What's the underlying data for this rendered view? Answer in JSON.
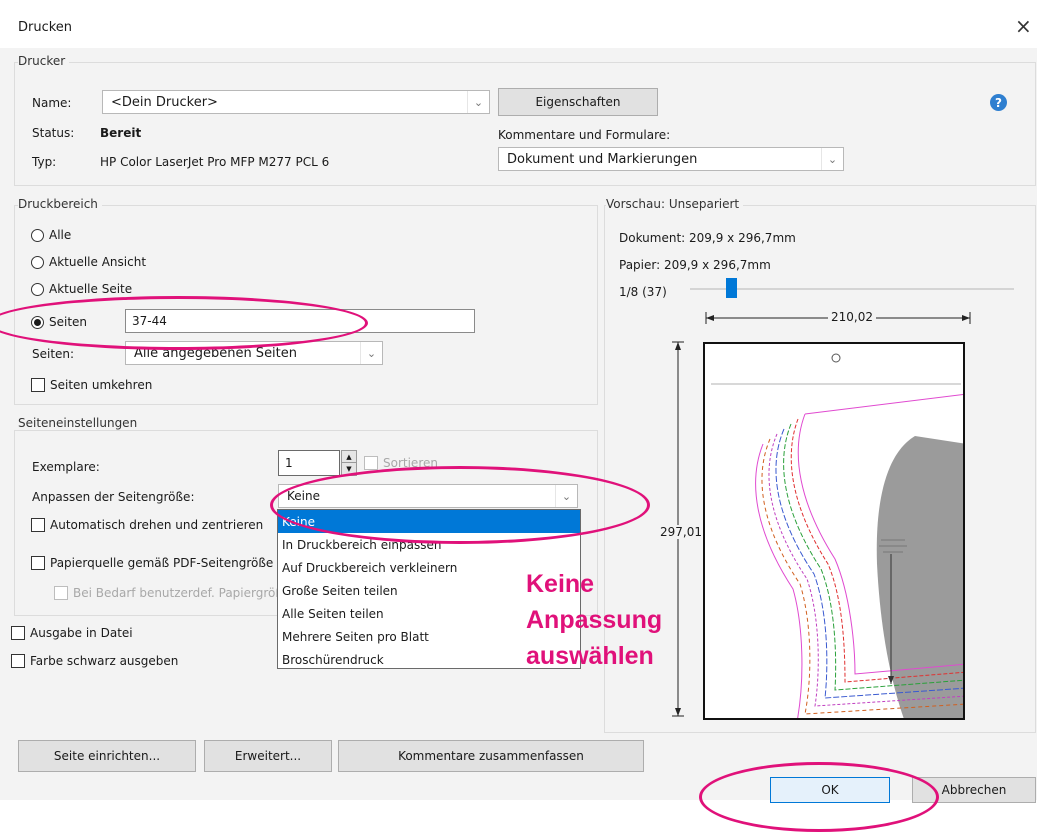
{
  "window": {
    "title": "Drucken",
    "close_glyph": "×"
  },
  "printer": {
    "group_label": "Drucker",
    "name_label": "Name:",
    "name_value": "<Dein Drucker>",
    "properties_button": "Eigenschaften",
    "status_label": "Status:",
    "status_value": "Bereit",
    "type_label": "Typ:",
    "type_value": "HP Color LaserJet Pro MFP M277 PCL 6",
    "comments_label": "Kommentare und Formulare:",
    "comments_value": "Dokument und Markierungen",
    "help_glyph": "?"
  },
  "print_range": {
    "group_label": "Druckbereich",
    "options": [
      "Alle",
      "Aktuelle Ansicht",
      "Aktuelle Seite",
      "Seiten"
    ],
    "selected": "Seiten",
    "pages_value": "37-44",
    "subset_label": "Seiten:",
    "subset_value": "Alle angegebenen Seiten",
    "reverse_label": "Seiten umkehren"
  },
  "page_setup": {
    "group_label": "Seiteneinstellungen",
    "copies_label": "Exemplare:",
    "copies_value": "1",
    "collate_label": "Sortieren",
    "fit_label": "Anpassen der Seitengröße:",
    "fit_value": "Keine",
    "auto_rotate_label": "Automatisch drehen und zentrieren",
    "paper_source_label": "Papierquelle gemäß PDF-Seitengröße",
    "custom_paper_label": "Bei Bedarf benutzerdef. Papiergröße verwenden",
    "dropdown_options": [
      "Keine",
      "In Druckbereich einpassen",
      "Auf Druckbereich verkleinern",
      "Große Seiten teilen",
      "Alle Seiten teilen",
      "Mehrere Seiten pro Blatt",
      "Broschürendruck"
    ]
  },
  "output": {
    "to_file_label": "Ausgabe in Datei",
    "black_label": "Farbe schwarz ausgeben"
  },
  "preview": {
    "group_label": "Vorschau: Unsepariert",
    "document_size": "Dokument: 209,9 x 296,7mm",
    "paper_size": "Papier: 209,9 x 296,7mm",
    "page_counter": "1/8 (37)",
    "width_label": "210,02",
    "height_label": "297,01",
    "slider_position": 0.125
  },
  "buttons": {
    "page_setup": "Seite einrichten...",
    "advanced": "Erweitert...",
    "summarize_comments": "Kommentare zusammenfassen",
    "ok": "OK",
    "cancel": "Abbrechen"
  },
  "annotation": {
    "lines": [
      "Keine",
      "Anpassung",
      "auswählen"
    ],
    "color": "#e0117a"
  }
}
